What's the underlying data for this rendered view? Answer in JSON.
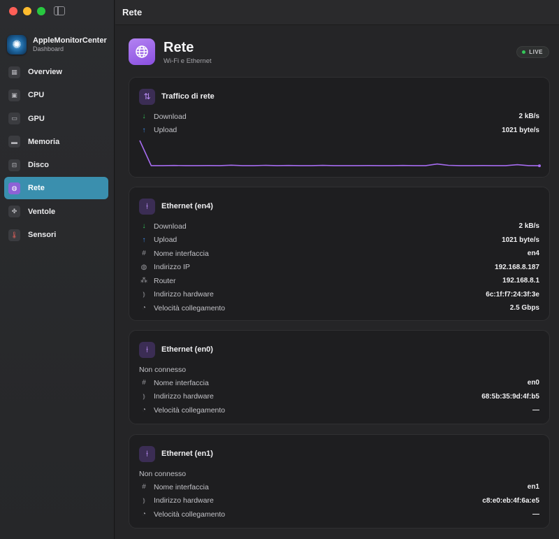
{
  "sidebar": {
    "app_name": "AppleMonitorCenter",
    "app_subtitle": "Dashboard",
    "items": [
      {
        "label": "Overview",
        "icon": "grid-icon"
      },
      {
        "label": "CPU",
        "icon": "cpu-icon"
      },
      {
        "label": "GPU",
        "icon": "display-icon"
      },
      {
        "label": "Memoria",
        "icon": "memory-icon"
      },
      {
        "label": "Disco",
        "icon": "disk-icon"
      },
      {
        "label": "Rete",
        "icon": "globe-icon",
        "active": true
      },
      {
        "label": "Ventole",
        "icon": "fan-icon"
      },
      {
        "label": "Sensori",
        "icon": "thermometer-icon"
      }
    ]
  },
  "titlebar": {
    "title": "Rete"
  },
  "header": {
    "title": "Rete",
    "subtitle": "Wi-Fi e Ethernet",
    "live_label": "LIVE"
  },
  "traffic": {
    "title": "Traffico di rete",
    "download_label": "Download",
    "download_value": "2 kB/s",
    "upload_label": "Upload",
    "upload_value": "1021 byte/s",
    "sparkline": [
      36,
      2,
      2,
      2.2,
      2,
      2,
      2.1,
      2,
      2.6,
      2,
      2,
      2.4,
      2,
      2.2,
      2,
      2,
      2.3,
      2,
      2,
      2,
      2.1,
      2,
      2,
      2.2,
      2,
      2,
      4.2,
      2.4,
      2,
      2,
      2.1,
      2,
      2,
      3.2,
      2,
      1.8
    ]
  },
  "en4": {
    "title": "Ethernet (en4)",
    "rows": [
      {
        "label": "Download",
        "value": "2 kB/s"
      },
      {
        "label": "Upload",
        "value": "1021 byte/s"
      },
      {
        "label": "Nome interfaccia",
        "value": "en4"
      },
      {
        "label": "Indirizzo IP",
        "value": "192.168.8.187"
      },
      {
        "label": "Router",
        "value": "192.168.8.1"
      },
      {
        "label": "Indirizzo hardware",
        "value": "6c:1f:f7:24:3f:3e"
      },
      {
        "label": "Velocità collegamento",
        "value": "2.5 Gbps"
      }
    ]
  },
  "en0": {
    "title": "Ethernet (en0)",
    "status": "Non connesso",
    "rows": [
      {
        "label": "Nome interfaccia",
        "value": "en0"
      },
      {
        "label": "Indirizzo hardware",
        "value": "68:5b:35:9d:4f:b5"
      },
      {
        "label": "Velocità collegamento",
        "value": "—"
      }
    ]
  },
  "en1": {
    "title": "Ethernet (en1)",
    "status": "Non connesso",
    "rows": [
      {
        "label": "Nome interfaccia",
        "value": "en1"
      },
      {
        "label": "Indirizzo hardware",
        "value": "c8:e0:eb:4f:6a:e5"
      },
      {
        "label": "Velocità collegamento",
        "value": "—"
      }
    ]
  },
  "colors": {
    "accent": "#8d62d6",
    "active_nav": "#3a8fae",
    "download": "#34c759",
    "upload": "#3d8ff5",
    "live": "#34c759",
    "chart_line": "#a66cf0"
  }
}
